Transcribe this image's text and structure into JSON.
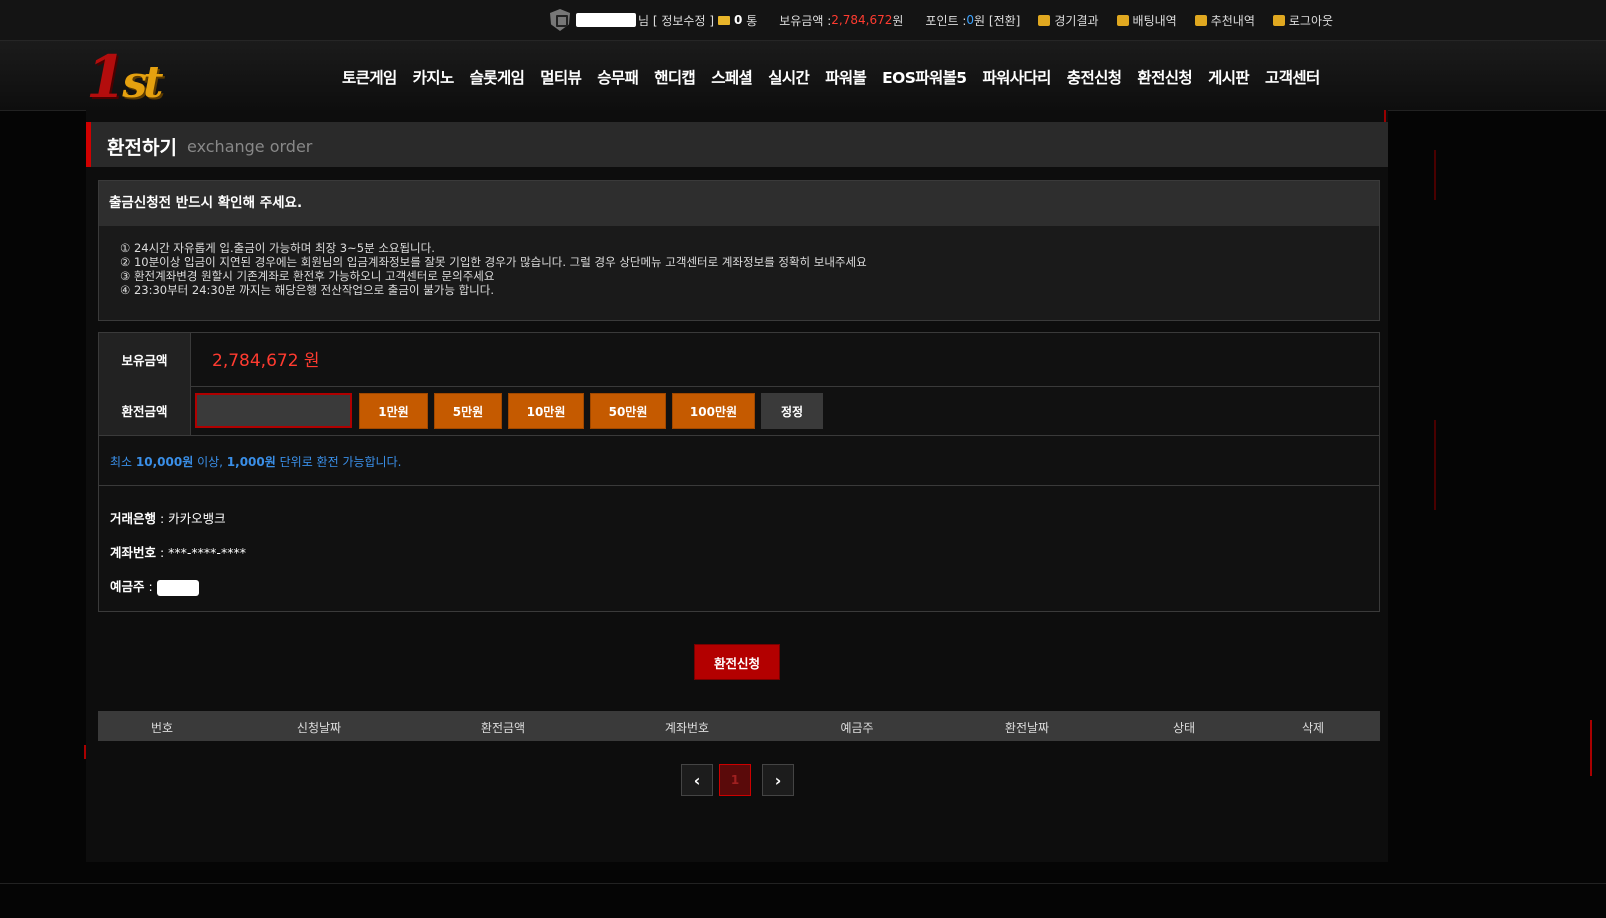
{
  "topbar": {
    "suffix": "님 [ 정보수정 ]",
    "messages_count": "0",
    "messages_unit": "통",
    "balance_label": "보유금액 : ",
    "balance_value": "2,784,672",
    "balance_unit": "원",
    "points_label": "포인트 : ",
    "points_value": "0",
    "points_unit": "원",
    "convert_label": "[전환]",
    "links": {
      "results": "경기결과",
      "betting": "배팅내역",
      "referral": "추천내역",
      "logout": "로그아웃"
    }
  },
  "logo": {
    "num": "1",
    "sup": "st"
  },
  "nav": [
    "토큰게임",
    "카지노",
    "슬롯게임",
    "멀티뷰",
    "승무패",
    "핸디캡",
    "스페셜",
    "실시간",
    "파워볼",
    "EOS파워볼5",
    "파워사다리",
    "충전신청",
    "환전신청",
    "게시판",
    "고객센터"
  ],
  "page": {
    "title": "환전하기",
    "subtitle": "exchange order"
  },
  "notice": {
    "heading": "출금신청전 반드시 확인해 주세요.",
    "lines": [
      "① 24시간 자유롭게 입.출금이 가능하며 최장 3~5분 소요됩니다.",
      "② 10분이상 입금이 지연된 경우에는 회원님의 입금계좌정보를 잘못 기입한 경우가 많습니다. 그럴 경우 상단메뉴 고객센터로 계좌정보를 정확히 보내주세요",
      "③ 환전계좌변경 원할시 기존계좌로 환전후 가능하오니 고객센터로 문의주세요",
      "④ 23:30부터 24:30분 까지는 해당은행 전산작업으로 출금이 불가능 합니다."
    ]
  },
  "form": {
    "balance_label": "보유금액",
    "balance_value": "2,784,672 원",
    "amount_label": "환전금액",
    "amount_value": "",
    "quick_buttons": [
      "1만원",
      "5만원",
      "10만원",
      "50만원",
      "100만원"
    ],
    "reset_label": "정정",
    "hint_prefix": "최소 ",
    "hint_min": "10,000원",
    "hint_mid": " 이상, ",
    "hint_unit": "1,000원",
    "hint_suffix": "  단위로 환전 가능합니다.",
    "bank_label": "거래은행",
    "bank_value": " : 카카오뱅크",
    "account_label": "계좌번호",
    "account_value": " : ***-****-****",
    "holder_label": "예금주",
    "holder_sep": " : "
  },
  "submit_label": "환전신청",
  "table": {
    "headers": [
      "번호",
      "신청날짜",
      "환전금액",
      "계좌번호",
      "예금주",
      "환전날짜",
      "상태",
      "삭제"
    ]
  },
  "pagination": {
    "current": "1",
    "prev": "‹",
    "next": "›"
  },
  "colors": {
    "accent": "#d00000",
    "button_orange": "#c55a00",
    "balance_red": "#ff3b30",
    "hint_blue": "#3a8fe8"
  }
}
